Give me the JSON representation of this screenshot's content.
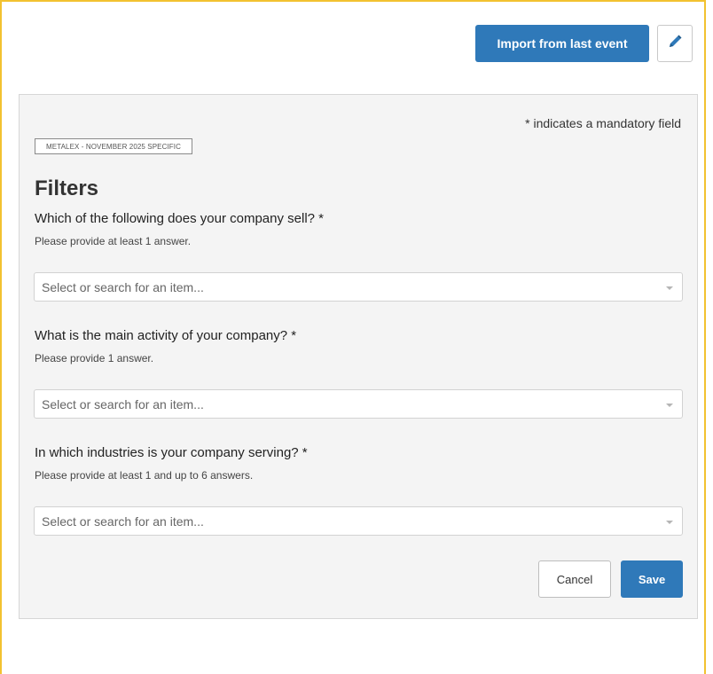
{
  "header": {
    "import_label": "Import from last event",
    "edit_icon": "pencil-icon"
  },
  "form": {
    "mandatory_note": "* indicates a mandatory field",
    "tag": "METALEX - NOVEMBER 2025 SPECIFIC",
    "section_title": "Filters",
    "questions": [
      {
        "label": "Which of the following does your company sell? *",
        "hint": "Please provide at least 1 answer.",
        "placeholder": "Select or search for an item..."
      },
      {
        "label": "What is the main activity of your company? *",
        "hint": "Please provide 1 answer.",
        "placeholder": "Select or search for an item..."
      },
      {
        "label": "In which industries is your company serving? *",
        "hint": "Please provide at least 1 and up to 6 answers.",
        "placeholder": "Select or search for an item..."
      }
    ],
    "cancel_label": "Cancel",
    "save_label": "Save"
  },
  "colors": {
    "primary": "#2f79b9",
    "frame_border": "#f2c230",
    "panel_bg": "#f4f4f4"
  }
}
